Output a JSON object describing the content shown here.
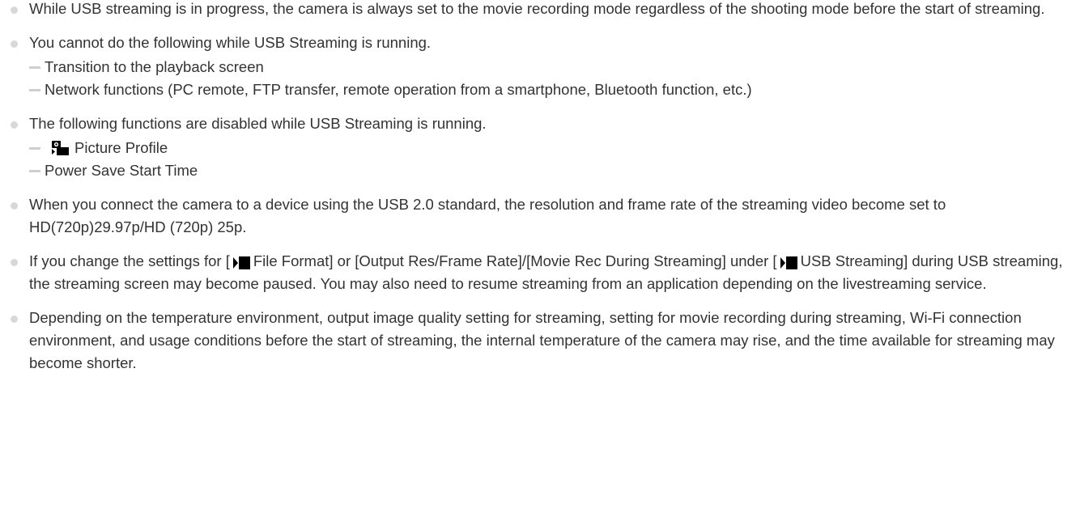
{
  "notes": [
    {
      "text": "While USB streaming is in progress, the camera is always set to the movie recording mode regardless of the shooting mode before the start of streaming."
    },
    {
      "text": "You cannot do the following while USB Streaming is running.",
      "sub": [
        "Transition to the playback screen",
        "Network functions (PC remote, FTP transfer, remote operation from a smartphone, Bluetooth function, etc.)"
      ]
    },
    {
      "text": "The following functions are disabled while USB Streaming is running.",
      "sub": [
        "Picture Profile",
        "Power Save Start Time"
      ]
    },
    {
      "text": "When you connect the camera to a device using the USB 2.0 standard, the resolution and frame rate of the streaming video become set to HD(720p)29.97p/HD (720p) 25p."
    },
    {
      "text_a": "If you change the settings for [",
      "text_b": "File Format] or [Output Res/Frame Rate]/[Movie Rec During Streaming] under [",
      "text_c": "USB Streaming] during USB streaming, the streaming screen may become paused. You may also need to resume streaming from an application depending on the livestreaming service."
    },
    {
      "text": "Depending on the temperature environment, output image quality setting for streaming, setting for movie recording during streaming, Wi-Fi connection environment, and usage conditions before the start of streaming, the internal temperature of the camera may rise, and the time available for streaming may become shorter."
    }
  ],
  "icons": {
    "bullet": "gray-dot-icon",
    "dash": "dash-icon",
    "movie": "movie-mode-icon",
    "picture_profile": "picture-profile-icon"
  },
  "colors": {
    "text": "#333333",
    "bullet": "#d8d8d8"
  }
}
